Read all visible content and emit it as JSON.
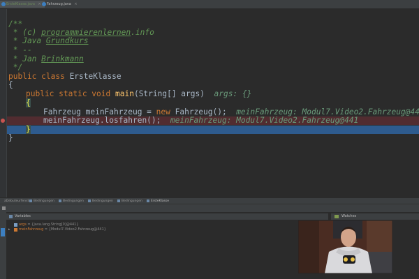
{
  "tabs": [
    {
      "label": "ErsteKlasse.java",
      "close": "×"
    },
    {
      "label": "Fahrzeug.java",
      "close": "×"
    }
  ],
  "code": {
    "l1": "/**",
    "l2_prefix": " * (c) ",
    "l2_link": "programmierenlernen",
    "l2_suffix": ".info",
    "l3_prefix": " * Java ",
    "l3_link": "Grundkurs",
    "l4": " * --",
    "l5_prefix": " * Jan ",
    "l5_link": "Brinkmann",
    "l6": " */",
    "l7_kw": "public class",
    "l7_name": " ErsteKlasse",
    "l8": "{",
    "l9_kw": "public static void",
    "l9_fn": "main",
    "l9_args": "(String[] args)",
    "l9_dbg": "args: {}",
    "l10": "{",
    "l11_a": "Fahrzeug meinFahrzeug = ",
    "l11_kw": "new",
    "l11_b": " Fahrzeug();",
    "l11_dbg": "meinFahrzeug: Modul7.Video2.Fahrzeug@441",
    "l12_a": "meinFahrzeug.losfahren();",
    "l12_dbg": "meinFahrzeug: Modul7.Video2.Fahrzeug@441",
    "l13": "}",
    "l14": "}"
  },
  "debug_tabs": [
    "aDebuteurfenster",
    "Bedingungen",
    "Bedingungen",
    "Bedingungen",
    "Bedingungen",
    "ErsteKlasse"
  ],
  "panels": {
    "variables": "Variables",
    "watches": "Watches"
  },
  "variables": [
    {
      "name": "args",
      "value": " = {java.lang.String[0]@441}"
    },
    {
      "name": "meinFahrzeug",
      "value": " = {Modul7.Video2.Fahrzeug@441}"
    }
  ],
  "colors": {
    "editor_bg": "#2b2b2b",
    "breakpoint_line": "#512c30",
    "current_line": "#2e5b8e",
    "keyword": "#cc7832",
    "comment": "#629755"
  }
}
